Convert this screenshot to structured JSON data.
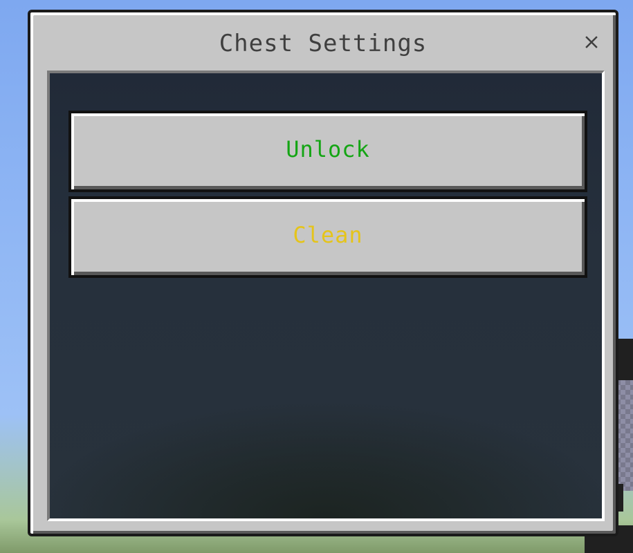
{
  "dialog": {
    "title": "Chest Settings",
    "close_icon": "close-icon"
  },
  "buttons": [
    {
      "label": "Unlock",
      "color": "#14a514"
    },
    {
      "label": "Clean",
      "color": "#e5c41a"
    }
  ],
  "colors": {
    "window": "#c6c6c6",
    "panel": "#26303c",
    "title_text": "#3f3f3f"
  }
}
